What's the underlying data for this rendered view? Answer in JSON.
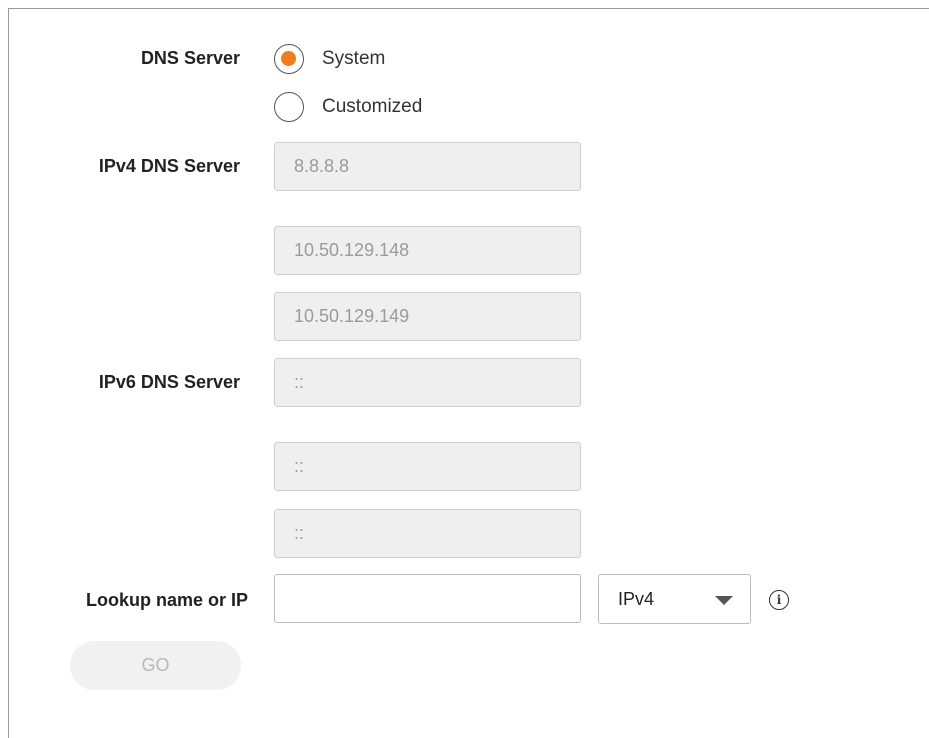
{
  "dns_server": {
    "label": "DNS Server",
    "options": [
      {
        "label": "System",
        "selected": true
      },
      {
        "label": "Customized",
        "selected": false
      }
    ]
  },
  "ipv4": {
    "label": "IPv4 DNS Server",
    "values": [
      "8.8.8.8",
      "10.50.129.148",
      "10.50.129.149"
    ]
  },
  "ipv6": {
    "label": "IPv6 DNS Server",
    "values": [
      "::",
      "::",
      "::"
    ]
  },
  "lookup": {
    "label": "Lookup name or IP",
    "value": "",
    "protocol_selected": "IPv4",
    "info_glyph": "i"
  },
  "go_button": {
    "label": "GO"
  },
  "colors": {
    "accent": "#f47a20",
    "disabled_field": "#efefef"
  }
}
